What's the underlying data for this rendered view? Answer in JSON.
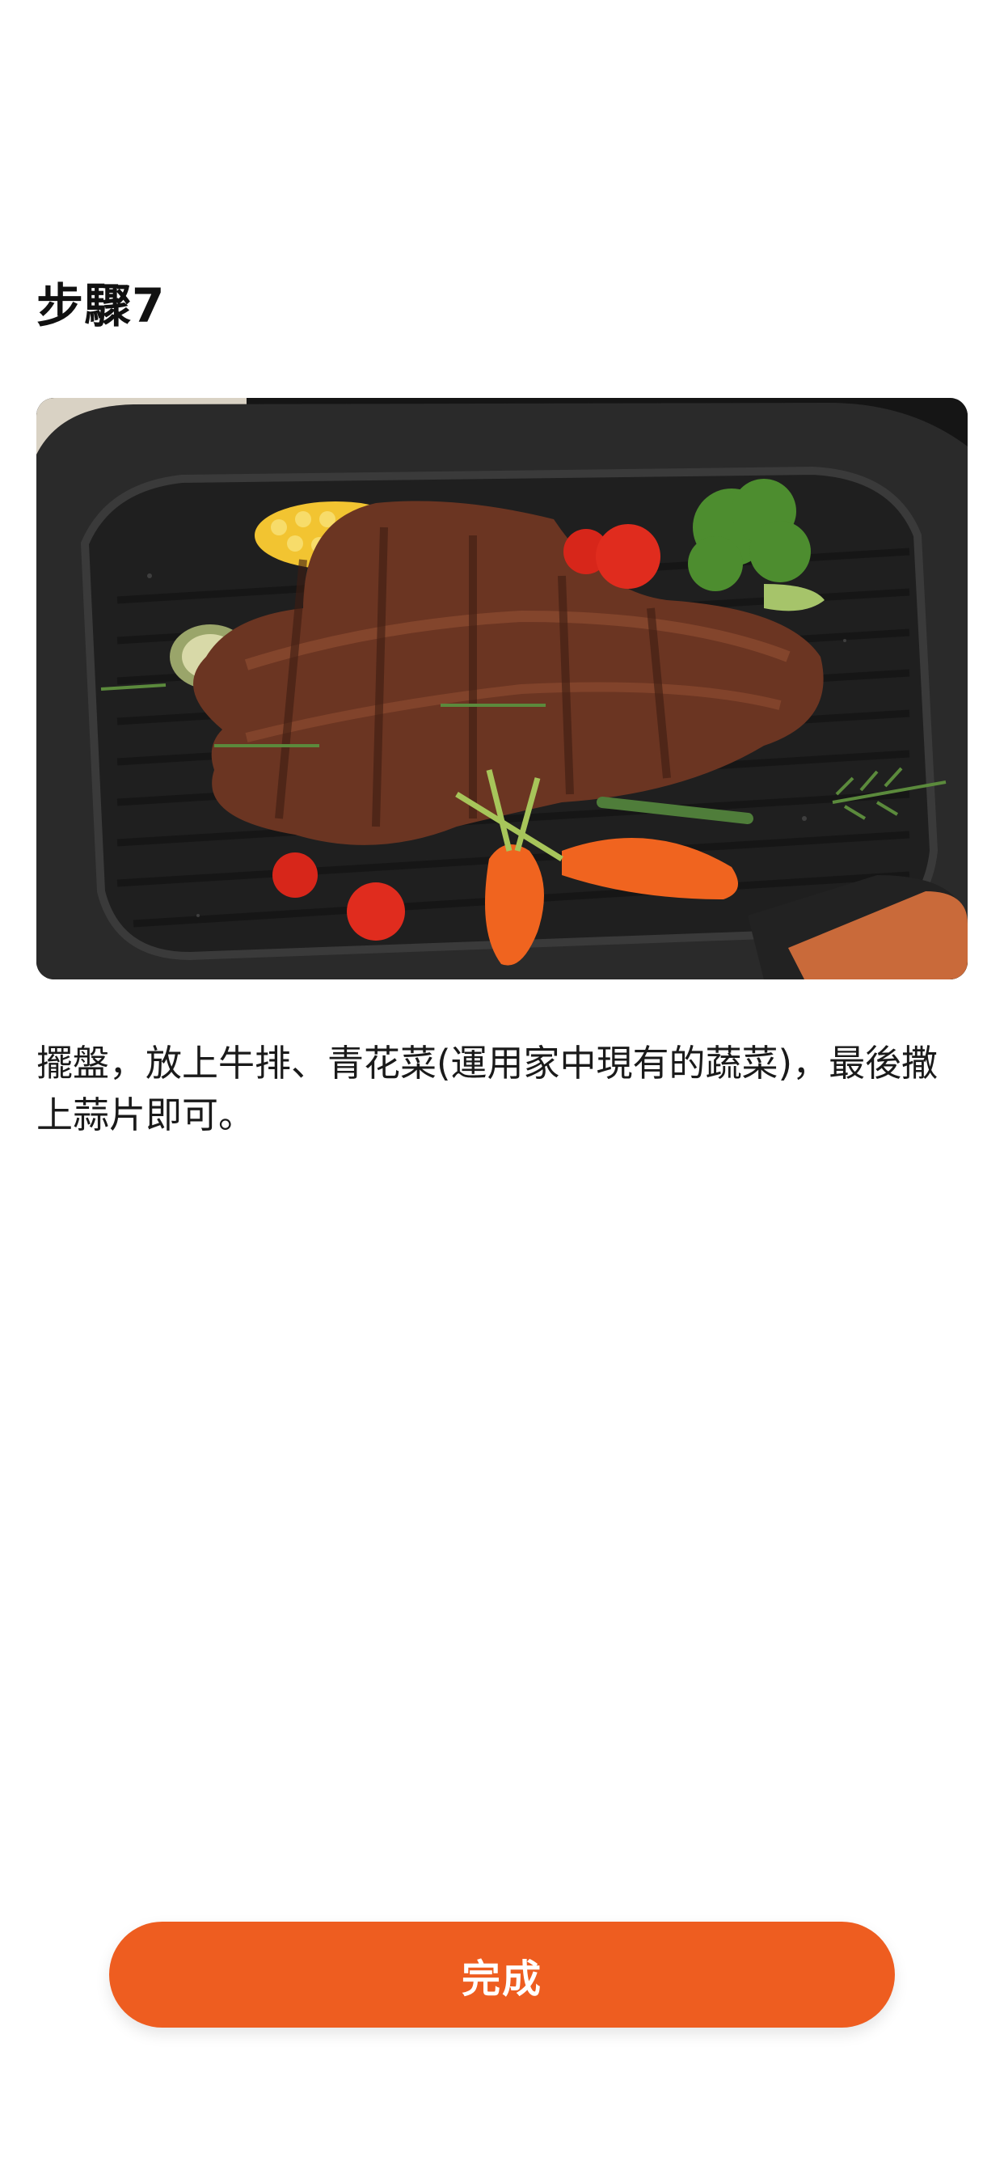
{
  "step": {
    "title": "步驟7",
    "description": "擺盤，放上牛排、青花菜(運用家中現有的蔬菜)，最後撒上蒜片即可。"
  },
  "photo": {
    "icon": "steak-dish-photo"
  },
  "actions": {
    "done_label": "完成"
  },
  "colors": {
    "accent": "#ee5d20",
    "text": "#111111",
    "background": "#ffffff"
  }
}
